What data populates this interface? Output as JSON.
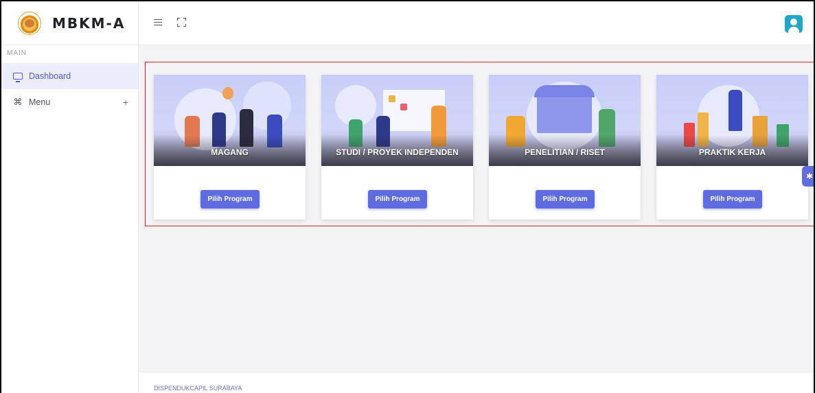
{
  "brand": {
    "name": "MBKM-A"
  },
  "sidebar": {
    "section_label": "MAIN",
    "items": [
      {
        "label": "Dashboard",
        "icon": "monitor-icon",
        "active": true
      },
      {
        "label": "Menu",
        "icon": "command-icon",
        "expand": "+"
      }
    ]
  },
  "topbar": {
    "menu_icon": "hamburger-icon",
    "fullscreen_icon": "fullscreen-icon",
    "user_icon": "user-icon"
  },
  "programs": [
    {
      "title": "MAGANG",
      "button": "Pilih Program"
    },
    {
      "title": "STUDI / PROYEK INDEPENDEN",
      "button": "Pilih Program"
    },
    {
      "title": "PENELITIAN / RISET",
      "button": "Pilih Program"
    },
    {
      "title": "PRAKTIK KERJA",
      "button": "Pilih Program"
    }
  ],
  "settings_icon": "gear-icon",
  "footer": {
    "text": "DISPENDUKCAPIL SURABAYA"
  },
  "colors": {
    "accent": "#5f6ce0",
    "highlight_border": "#e01e1e",
    "avatar": "#23a7c9"
  }
}
